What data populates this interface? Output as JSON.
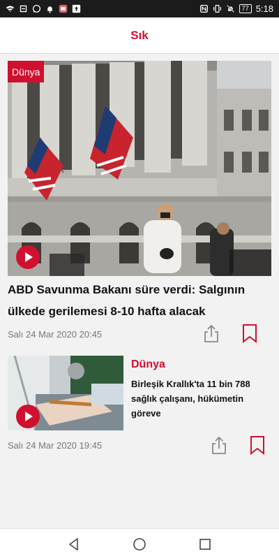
{
  "status_bar": {
    "time": "5:18",
    "battery": "77",
    "left_icons": [
      "wifi-icon",
      "sync-icon",
      "whatsapp-icon",
      "notification-bell-icon",
      "app-icon",
      "upload-icon"
    ],
    "right_icons": [
      "nfc-icon",
      "vibrate-icon",
      "mute-icon",
      "battery-icon"
    ]
  },
  "header": {
    "title": "Sık"
  },
  "featured": {
    "category": "Dünya",
    "title": "ABD Savunma Bakanı süre verdi: Salgının ülkede gerilemesi 8-10 hafta alacak",
    "date": "Salı 24 Mar 2020 20:45",
    "has_video": true
  },
  "article2": {
    "category": "Dünya",
    "title": "Birleşik Krallık'ta 11 bin 788 sağlık çalışanı, hükümetin göreve",
    "date": "Salı 24 Mar 2020 19:45",
    "has_video": true
  },
  "colors": {
    "accent": "#d0102f",
    "background": "#f2f2f2"
  },
  "nav": [
    "back-icon",
    "home-icon",
    "recents-icon"
  ]
}
